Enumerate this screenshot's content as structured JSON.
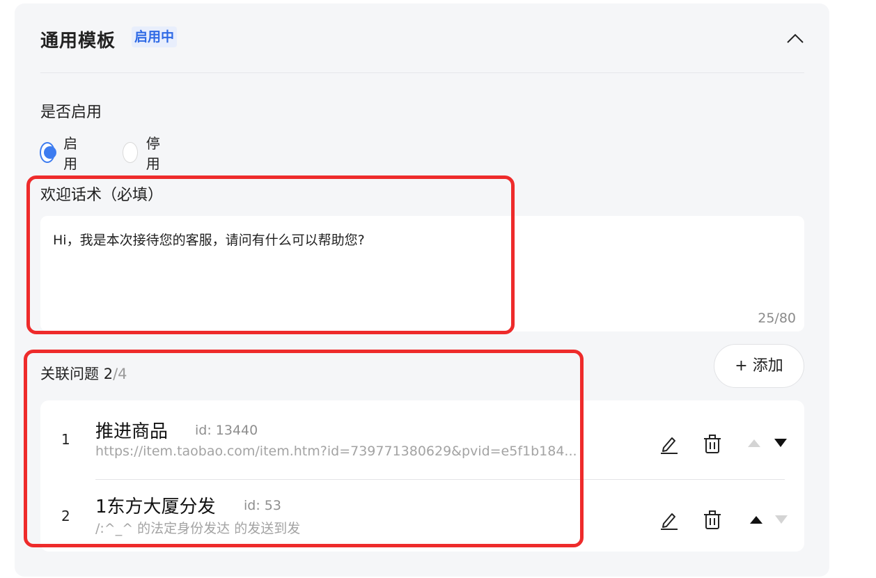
{
  "panel": {
    "title": "通用模板",
    "status_badge": "启用中"
  },
  "enable": {
    "label": "是否启用",
    "options": [
      "启用",
      "停用"
    ],
    "selected": "启用"
  },
  "welcome": {
    "label": "欢迎话术（必填）",
    "value": "Hi，我是本次接待您的客服，请问有什么可以帮助您?",
    "counter": "25/80"
  },
  "related": {
    "label": "关联问题",
    "count": "2",
    "total": "/4",
    "add_label": "+ 添加",
    "items": [
      {
        "index": "1",
        "title": "推进商品",
        "id": "id: 13440",
        "subtitle": "https://item.taobao.com/item.htm?id=739771380629&pvid=e5f1b184..."
      },
      {
        "index": "2",
        "title": "1东方大厦分发",
        "id": "id: 53",
        "subtitle": "/:^_^ 的法定身份发达 的发送到发"
      }
    ]
  },
  "colors": {
    "accent": "#3d7cf0",
    "highlight_border": "#ee2b2b",
    "panel_bg": "#f5f6f8"
  }
}
